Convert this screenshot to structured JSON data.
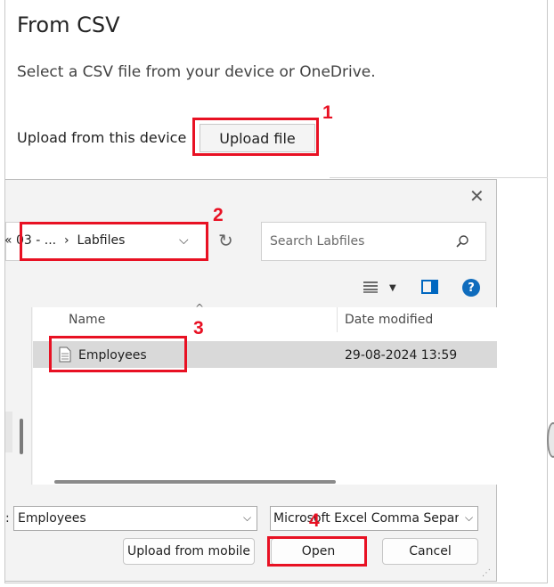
{
  "header": {
    "title": "From CSV",
    "subtitle": "Select a CSV file from your device or OneDrive.",
    "upload_label": "Upload from this device",
    "upload_button": "Upload file"
  },
  "dialog": {
    "close_symbol": "✕",
    "address": {
      "path": "« 03 - ...  ›  Labfiles",
      "chevron": "⌵",
      "refresh_symbol": "↻"
    },
    "search_placeholder": "Search Labfiles",
    "columns": {
      "name": "Name",
      "date": "Date modified",
      "sort_caret": "^"
    },
    "files": [
      {
        "name": "Employees",
        "date": "29-08-2024 13:59",
        "icon": "document-icon"
      }
    ],
    "file_name_label": ":",
    "file_name_value": "Employees",
    "file_type": "Microsoft Excel Comma Separated Values",
    "buttons": {
      "upload_from_mobile": "Upload from mobile",
      "open": "Open",
      "cancel": "Cancel"
    }
  },
  "annotations": [
    "1",
    "2",
    "3",
    "4"
  ],
  "colors": {
    "annotation": "#e81123",
    "accent": "#0067c0"
  }
}
